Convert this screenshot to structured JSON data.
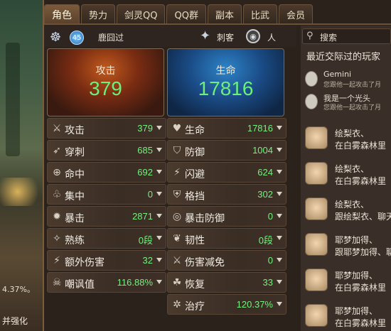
{
  "scene": {
    "hint_pct": "4.37%。",
    "hint_strengthen": "并强化"
  },
  "tabs": [
    "角色",
    "势力",
    "剑灵QQ",
    "QQ群",
    "副本",
    "比武",
    "会员"
  ],
  "header": {
    "level": "45",
    "name": "鹿囧过",
    "job": "刺客",
    "gender": "人"
  },
  "cards": {
    "attack": {
      "label": "攻击",
      "value": "379"
    },
    "hp": {
      "label": "生命",
      "value": "17816"
    }
  },
  "stats_left": [
    {
      "icon": "swords-icon",
      "label": "攻击",
      "value": "379"
    },
    {
      "icon": "pierce-icon",
      "label": "穿刺",
      "value": "685"
    },
    {
      "icon": "target-icon",
      "label": "命中",
      "value": "692"
    },
    {
      "icon": "focus-icon",
      "label": "集中",
      "value": "0"
    },
    {
      "icon": "burst-icon",
      "label": "暴击",
      "value": "2871"
    },
    {
      "icon": "mastery-icon",
      "label": "熟练",
      "value": "0段"
    },
    {
      "icon": "extra-damage-icon",
      "label": "额外伤害",
      "value": "32"
    },
    {
      "icon": "skull-icon",
      "label": "嘲讽值",
      "value": "116.88%"
    }
  ],
  "stats_right": [
    {
      "icon": "heart-icon",
      "label": "生命",
      "value": "17816"
    },
    {
      "icon": "shield-icon",
      "label": "防御",
      "value": "1004"
    },
    {
      "icon": "dodge-icon",
      "label": "闪避",
      "value": "624"
    },
    {
      "icon": "block-icon",
      "label": "格挡",
      "value": "302"
    },
    {
      "icon": "crit-defense-icon",
      "label": "暴击防御",
      "value": "0"
    },
    {
      "icon": "toughness-icon",
      "label": "韧性",
      "value": "0段"
    },
    {
      "icon": "damage-reduction-icon",
      "label": "伤害减免",
      "value": "0"
    },
    {
      "icon": "recovery-icon",
      "label": "恢复",
      "value": "33"
    },
    {
      "icon": "heal-icon",
      "label": "治疗",
      "value": "120.37%"
    }
  ],
  "sidebar": {
    "search": "搜索",
    "recent_title": "最近交际过的玩家",
    "friends": [
      {
        "name": "Gemini",
        "desc": "您跟他一起攻击了月"
      },
      {
        "name": "我是一个光头",
        "desc": "您跟他一起攻击了月"
      }
    ],
    "messages": [
      {
        "line1": "绘梨衣、",
        "line2": "在白雾森林里"
      },
      {
        "line1": "绘梨衣、",
        "line2": "在白雾森林里"
      },
      {
        "line1": "绘梨衣、",
        "line2": "跟绘梨衣、聊天"
      },
      {
        "line1": "耶梦加得、",
        "line2": "跟耶梦加得、聊"
      },
      {
        "line1": "耶梦加得、",
        "line2": "在白雾森林里"
      },
      {
        "line1": "耶梦加得、",
        "line2": "在白雾森林里"
      }
    ]
  }
}
